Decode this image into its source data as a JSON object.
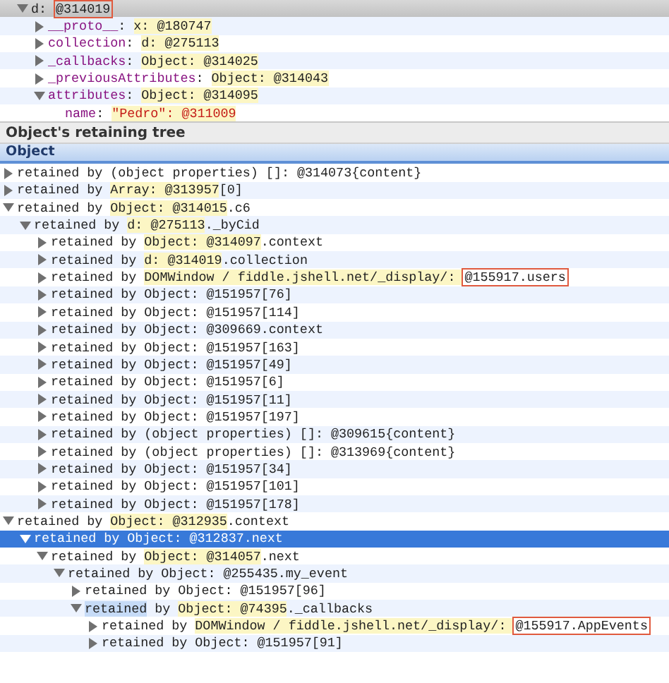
{
  "object_tree": {
    "focused": false,
    "nodes": [
      {
        "expanded": true,
        "selected": true,
        "parts": [
          {
            "kind": "plain",
            "text": "d: "
          },
          {
            "kind": "boxed",
            "text": "@314019"
          }
        ],
        "children": [
          {
            "expanded": false,
            "selected": false,
            "parts": [
              {
                "kind": "key",
                "text": "__proto__"
              },
              {
                "kind": "plain",
                "text": ": "
              },
              {
                "kind": "value",
                "text": "x: @180747"
              }
            ]
          },
          {
            "expanded": false,
            "selected": false,
            "parts": [
              {
                "kind": "key",
                "text": "collection"
              },
              {
                "kind": "plain",
                "text": ": "
              },
              {
                "kind": "value",
                "text": "d: @275113"
              }
            ]
          },
          {
            "expanded": false,
            "selected": false,
            "parts": [
              {
                "kind": "key",
                "text": "_callbacks"
              },
              {
                "kind": "plain",
                "text": ": "
              },
              {
                "kind": "value",
                "text": "Object: @314025"
              }
            ]
          },
          {
            "expanded": false,
            "selected": false,
            "parts": [
              {
                "kind": "key",
                "text": "_previousAttributes"
              },
              {
                "kind": "plain",
                "text": ": "
              },
              {
                "kind": "value",
                "text": "Object: @314043"
              }
            ]
          },
          {
            "expanded": true,
            "selected": false,
            "parts": [
              {
                "kind": "key",
                "text": "attributes"
              },
              {
                "kind": "plain",
                "text": ": "
              },
              {
                "kind": "value",
                "text": "Object: @314095"
              }
            ],
            "children": [
              {
                "selected": false,
                "parts": [
                  {
                    "kind": "key",
                    "text": "name"
                  },
                  {
                    "kind": "plain",
                    "text": ": "
                  },
                  {
                    "kind": "string",
                    "text": "\"Pedro\": @311009"
                  }
                ]
              }
            ]
          }
        ]
      }
    ]
  },
  "retainers_title": "Object's retaining tree",
  "retainers": {
    "focused": true,
    "column": "Object",
    "nodes": [
      {
        "expanded": false,
        "selected": false,
        "parts": [
          {
            "kind": "plain",
            "text": "retained by (object properties) []: @314073{content}"
          }
        ]
      },
      {
        "expanded": false,
        "selected": false,
        "parts": [
          {
            "kind": "plain",
            "text": "retained by "
          },
          {
            "kind": "value",
            "text": "Array: @313957"
          },
          {
            "kind": "plain",
            "text": "[0]"
          }
        ]
      },
      {
        "expanded": true,
        "selected": false,
        "parts": [
          {
            "kind": "plain",
            "text": "retained by "
          },
          {
            "kind": "value",
            "text": "Object: @314015"
          },
          {
            "kind": "plain",
            "text": ".c6"
          }
        ],
        "children": [
          {
            "expanded": true,
            "selected": false,
            "parts": [
              {
                "kind": "plain",
                "text": "retained by "
              },
              {
                "kind": "value",
                "text": "d: @275113"
              },
              {
                "kind": "plain",
                "text": "._byCid"
              }
            ],
            "children": [
              {
                "expanded": false,
                "selected": false,
                "parts": [
                  {
                    "kind": "plain",
                    "text": "retained by "
                  },
                  {
                    "kind": "value",
                    "text": "Object: @314097"
                  },
                  {
                    "kind": "plain",
                    "text": ".context"
                  }
                ]
              },
              {
                "expanded": false,
                "selected": false,
                "parts": [
                  {
                    "kind": "plain",
                    "text": "retained by "
                  },
                  {
                    "kind": "value",
                    "text": "d: @314019"
                  },
                  {
                    "kind": "plain",
                    "text": ".collection"
                  }
                ]
              },
              {
                "expanded": false,
                "selected": false,
                "parts": [
                  {
                    "kind": "plain",
                    "text": "retained by "
                  },
                  {
                    "kind": "value",
                    "text": "DOMWindow / fiddle.jshell.net/_display/: "
                  },
                  {
                    "kind": "boxed",
                    "text": "@155917.users"
                  }
                ]
              },
              {
                "expanded": false,
                "selected": false,
                "parts": [
                  {
                    "kind": "plain",
                    "text": "retained by Object: @151957[76]"
                  }
                ]
              },
              {
                "expanded": false,
                "selected": false,
                "parts": [
                  {
                    "kind": "plain",
                    "text": "retained by Object: @151957[114]"
                  }
                ]
              },
              {
                "expanded": false,
                "selected": false,
                "parts": [
                  {
                    "kind": "plain",
                    "text": "retained by Object: @309669.context"
                  }
                ]
              },
              {
                "expanded": false,
                "selected": false,
                "parts": [
                  {
                    "kind": "plain",
                    "text": "retained by Object: @151957[163]"
                  }
                ]
              },
              {
                "expanded": false,
                "selected": false,
                "parts": [
                  {
                    "kind": "plain",
                    "text": "retained by Object: @151957[49]"
                  }
                ]
              },
              {
                "expanded": false,
                "selected": false,
                "parts": [
                  {
                    "kind": "plain",
                    "text": "retained by Object: @151957[6]"
                  }
                ]
              },
              {
                "expanded": false,
                "selected": false,
                "parts": [
                  {
                    "kind": "plain",
                    "text": "retained by Object: @151957[11]"
                  }
                ]
              },
              {
                "expanded": false,
                "selected": false,
                "parts": [
                  {
                    "kind": "plain",
                    "text": "retained by Object: @151957[197]"
                  }
                ]
              },
              {
                "expanded": false,
                "selected": false,
                "parts": [
                  {
                    "kind": "plain",
                    "text": "retained by (object properties) []: @309615{content}"
                  }
                ]
              },
              {
                "expanded": false,
                "selected": false,
                "parts": [
                  {
                    "kind": "plain",
                    "text": "retained by (object properties) []: @313969{content}"
                  }
                ]
              },
              {
                "expanded": false,
                "selected": false,
                "parts": [
                  {
                    "kind": "plain",
                    "text": "retained by Object: @151957[34]"
                  }
                ]
              },
              {
                "expanded": false,
                "selected": false,
                "parts": [
                  {
                    "kind": "plain",
                    "text": "retained by Object: @151957[101]"
                  }
                ]
              },
              {
                "expanded": false,
                "selected": false,
                "parts": [
                  {
                    "kind": "plain",
                    "text": "retained by Object: @151957[178]"
                  }
                ]
              }
            ]
          }
        ]
      },
      {
        "expanded": true,
        "selected": false,
        "parts": [
          {
            "kind": "plain",
            "text": "retained by "
          },
          {
            "kind": "value",
            "text": "Object: @312935"
          },
          {
            "kind": "plain",
            "text": ".context"
          }
        ],
        "children": [
          {
            "expanded": true,
            "selected": true,
            "parts": [
              {
                "kind": "plain",
                "text": "retained by Object: @312837.next"
              }
            ],
            "children": [
              {
                "expanded": true,
                "selected": false,
                "parts": [
                  {
                    "kind": "plain",
                    "text": "retained by "
                  },
                  {
                    "kind": "value",
                    "text": "Object: @314057"
                  },
                  {
                    "kind": "plain",
                    "text": ".next"
                  }
                ],
                "children": [
                  {
                    "expanded": true,
                    "selected": false,
                    "parts": [
                      {
                        "kind": "plain",
                        "text": "retained by Object: @255435.my_event"
                      }
                    ],
                    "children": [
                      {
                        "expanded": false,
                        "selected": false,
                        "parts": [
                          {
                            "kind": "plain",
                            "text": "retained by Object: @151957[96]"
                          }
                        ]
                      },
                      {
                        "expanded": true,
                        "selected": false,
                        "parts": [
                          {
                            "kind": "match",
                            "text": "retained"
                          },
                          {
                            "kind": "plain",
                            "text": " by "
                          },
                          {
                            "kind": "value",
                            "text": "Object: @74395"
                          },
                          {
                            "kind": "plain",
                            "text": "._callbacks"
                          }
                        ],
                        "children": [
                          {
                            "expanded": false,
                            "selected": false,
                            "parts": [
                              {
                                "kind": "plain",
                                "text": "retained by "
                              },
                              {
                                "kind": "value",
                                "text": "DOMWindow / fiddle.jshell.net/_display/: "
                              },
                              {
                                "kind": "boxed",
                                "text": "@155917.AppEvents"
                              }
                            ]
                          },
                          {
                            "expanded": false,
                            "selected": false,
                            "parts": [
                              {
                                "kind": "plain",
                                "text": "retained by Object: @151957[91]"
                              }
                            ]
                          }
                        ]
                      }
                    ]
                  }
                ]
              }
            ]
          }
        ]
      }
    ]
  }
}
